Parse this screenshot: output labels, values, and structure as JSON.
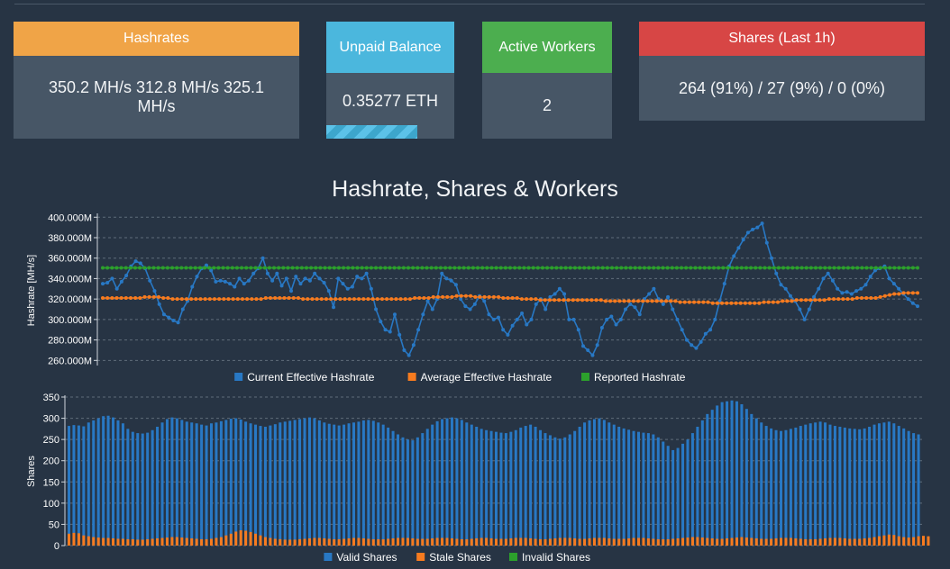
{
  "cards": {
    "hashrates": {
      "title": "Hashrates",
      "value": "350.2 MH/s  312.8 MH/s   325.1 MH/s"
    },
    "unpaid": {
      "title": "Unpaid Balance",
      "value": "0.35277 ETH",
      "progress": 0.71
    },
    "workers": {
      "title": "Active Workers",
      "value": "2"
    },
    "shares": {
      "title": "Shares (Last 1h)",
      "value": "264 (91%) / 27 (9%) / 0 (0%)"
    }
  },
  "title": "Hashrate, Shares & Workers",
  "colors": {
    "current": "#2878c4",
    "average": "#f77b1f",
    "reported": "#2ca02c",
    "valid": "#2878c4",
    "stale": "#f77b1f",
    "invalid": "#2ca02c"
  },
  "chart_data": [
    {
      "type": "line",
      "ylabel": "Hashrate [MH/s]",
      "ylim": [
        255,
        402
      ],
      "yticks": [
        "400.000M",
        "380.000M",
        "360.000M",
        "340.000M",
        "320.000M",
        "300.000M",
        "280.000M",
        "260.000M"
      ],
      "ytick_values": [
        400,
        380,
        360,
        340,
        320,
        300,
        280,
        260
      ],
      "grid": true,
      "legend_position": "bottom",
      "series": [
        {
          "name": "Current Effective Hashrate",
          "values": [
            335,
            336,
            340,
            330,
            337,
            343,
            352,
            357,
            355,
            350,
            338,
            328,
            315,
            305,
            302,
            299,
            297,
            310,
            318,
            332,
            342,
            350,
            353,
            348,
            337,
            338,
            337,
            335,
            332,
            340,
            335,
            338,
            345,
            350,
            360,
            345,
            338,
            345,
            333,
            340,
            328,
            342,
            335,
            340,
            338,
            345,
            340,
            336,
            328,
            312,
            340,
            335,
            330,
            332,
            342,
            340,
            345,
            330,
            310,
            298,
            290,
            288,
            305,
            285,
            270,
            265,
            275,
            290,
            305,
            318,
            310,
            320,
            345,
            340,
            338,
            334,
            320,
            313,
            310,
            315,
            323,
            318,
            305,
            300,
            302,
            290,
            285,
            294,
            300,
            306,
            295,
            300,
            315,
            320,
            310,
            322,
            325,
            330,
            325,
            300,
            300,
            290,
            274,
            270,
            265,
            275,
            292,
            300,
            303,
            295,
            300,
            310,
            315,
            312,
            305,
            320,
            325,
            330,
            320,
            315,
            322,
            310,
            300,
            290,
            280,
            275,
            272,
            278,
            286,
            290,
            300,
            318,
            335,
            352,
            362,
            370,
            378,
            385,
            388,
            390,
            394,
            375,
            360,
            345,
            334,
            330,
            323,
            318,
            310,
            300,
            310,
            322,
            330,
            340,
            345,
            338,
            330,
            326,
            327,
            325,
            328,
            330,
            334,
            342,
            348,
            350,
            352,
            340,
            335,
            330,
            325,
            320,
            316,
            313
          ]
        },
        {
          "name": "Average Effective Hashrate",
          "values": [
            321,
            321,
            321,
            321,
            321,
            321,
            321,
            321,
            321,
            322,
            322,
            322,
            322,
            321,
            321,
            320,
            320,
            320,
            320,
            320,
            320,
            320,
            320,
            320,
            320,
            320,
            320,
            320,
            320,
            320,
            320,
            320,
            320,
            320,
            320,
            321,
            321,
            321,
            321,
            321,
            321,
            321,
            321,
            320,
            320,
            320,
            320,
            320,
            320,
            320,
            320,
            320,
            320,
            320,
            320,
            320,
            320,
            320,
            320,
            320,
            320,
            320,
            320,
            320,
            320,
            320,
            320,
            321,
            321,
            321,
            321,
            322,
            322,
            322,
            322,
            322,
            323,
            323,
            323,
            323,
            322,
            322,
            322,
            322,
            322,
            322,
            321,
            321,
            321,
            321,
            320,
            320,
            320,
            320,
            319,
            319,
            319,
            319,
            319,
            319,
            319,
            319,
            319,
            319,
            319,
            319,
            319,
            319,
            318,
            318,
            318,
            318,
            318,
            318,
            318,
            318,
            318,
            318,
            318,
            318,
            318,
            318,
            318,
            318,
            317,
            317,
            317,
            317,
            317,
            317,
            317,
            316,
            316,
            316,
            316,
            316,
            316,
            316,
            316,
            316,
            316,
            316,
            317,
            317,
            317,
            317,
            318,
            318,
            318,
            319,
            319,
            319,
            319,
            319,
            319,
            319,
            320,
            320,
            320,
            320,
            320,
            320,
            321,
            321,
            321,
            321,
            321,
            322,
            323,
            324,
            325,
            325,
            326,
            326,
            326,
            326
          ]
        },
        {
          "name": "Reported Hashrate",
          "values": [
            350.5,
            350.5,
            350.5,
            350.5,
            350.5,
            350.5,
            350.5,
            350.5,
            350.5,
            350.5,
            350.5,
            350.5,
            350.5,
            350.5,
            350.5,
            350.5,
            350.5,
            350.5,
            350.5,
            350.5,
            350.5,
            350.5,
            350.5,
            350.5,
            350.5,
            350.5,
            350.5,
            350.5,
            350.5,
            350.5,
            350.5,
            350.5,
            350.5,
            350.5,
            350.5,
            350.5,
            350.5,
            350.5,
            350.5,
            350.5,
            350.5,
            350.5,
            350.5,
            350.5,
            350.5,
            350.5,
            350.5,
            350.5,
            350.5,
            350.5,
            350.5,
            350.5,
            350.5,
            350.5,
            350.5,
            350.5,
            350.5,
            350.5,
            350.5,
            350.5,
            350.5,
            350.5,
            350.5,
            350.5,
            350.5,
            350.5,
            350.5,
            350.5,
            350.5,
            350.5,
            350.5,
            350.5,
            350.5,
            350.5,
            350.5,
            350.5,
            350.5,
            350.5,
            350.5,
            350.5,
            350.5,
            350.5,
            350.5,
            350.5,
            350.5,
            350.5,
            350.5,
            350.5,
            350.5,
            350.5,
            350.5,
            350.5,
            350.5,
            350.5,
            350.5,
            350.5,
            350.5,
            350.5,
            350.5,
            350.5,
            350.5,
            350.5,
            350.5,
            350.5,
            350.5,
            350.5,
            350.5,
            350.5,
            350.5,
            350.5,
            350.5,
            350.5,
            350.5,
            350.5,
            350.5,
            350.5,
            350.5,
            350.5,
            350.5,
            350.5,
            350.5,
            350.5,
            350.5,
            350.5,
            350.5,
            350.5,
            350.5,
            350.5,
            350.5,
            350.5,
            350.5,
            350.5,
            350.5,
            350.5,
            350.5,
            350.5,
            350.5,
            350.5,
            350.5,
            350.5,
            350.5,
            350.5,
            350.5,
            350.5,
            350.5,
            350.5,
            350.5,
            350.5,
            350.5,
            350.5,
            350.5,
            350.5,
            350.5,
            350.5,
            350.5,
            350.5,
            350.5,
            350.5,
            350.5,
            350.5,
            350.5,
            350.5,
            350.5,
            350.5,
            350.5,
            350.5,
            350.5,
            350.5,
            350.5,
            350.5,
            350.5,
            350.5,
            350.5,
            350.5,
            350.5,
            350.5,
            350.5
          ]
        }
      ]
    },
    {
      "type": "bar",
      "ylabel": "Shares",
      "ylim": [
        0,
        350
      ],
      "yticks": [
        "350",
        "300",
        "250",
        "200",
        "150",
        "100",
        "50",
        "0"
      ],
      "ytick_values": [
        350,
        300,
        250,
        200,
        150,
        100,
        50,
        0
      ],
      "grid": true,
      "legend_position": "bottom",
      "series": [
        {
          "name": "Valid Shares",
          "values": [
            282,
            284,
            283,
            281,
            290,
            295,
            300,
            305,
            306,
            302,
            295,
            288,
            275,
            268,
            265,
            264,
            266,
            272,
            280,
            290,
            298,
            302,
            300,
            296,
            292,
            290,
            288,
            285,
            283,
            288,
            290,
            293,
            296,
            299,
            300,
            297,
            292,
            288,
            285,
            282,
            280,
            283,
            286,
            290,
            292,
            294,
            296,
            298,
            300,
            302,
            300,
            295,
            290,
            287,
            285,
            283,
            285,
            288,
            290,
            292,
            295,
            296,
            294,
            290,
            285,
            278,
            270,
            262,
            255,
            250,
            248,
            255,
            265,
            275,
            285,
            293,
            298,
            300,
            302,
            300,
            296,
            290,
            285,
            280,
            275,
            272,
            270,
            268,
            266,
            265,
            268,
            272,
            278,
            282,
            285,
            280,
            272,
            265,
            260,
            255,
            252,
            255,
            262,
            270,
            280,
            290,
            295,
            298,
            300,
            296,
            290,
            285,
            280,
            276,
            273,
            270,
            268,
            266,
            265,
            262,
            255,
            245,
            235,
            225,
            230,
            240,
            250,
            265,
            280,
            295,
            310,
            320,
            330,
            338,
            340,
            342,
            340,
            333,
            322,
            310,
            300,
            290,
            282,
            276,
            272,
            270,
            272,
            275,
            278,
            282,
            285,
            288,
            290,
            292,
            290,
            285,
            282,
            280,
            278,
            276,
            275,
            274,
            276,
            280,
            285,
            288,
            290,
            292,
            288,
            282,
            276,
            270,
            265,
            262
          ]
        },
        {
          "name": "Stale Shares",
          "values": [
            28,
            30,
            29,
            24,
            22,
            20,
            19,
            18,
            18,
            17,
            16,
            16,
            15,
            15,
            14,
            14,
            15,
            16,
            17,
            18,
            19,
            20,
            20,
            19,
            18,
            17,
            16,
            15,
            15,
            16,
            18,
            20,
            24,
            28,
            33,
            36,
            35,
            32,
            28,
            24,
            20,
            18,
            16,
            15,
            14,
            14,
            14,
            15,
            16,
            17,
            18,
            18,
            17,
            16,
            15,
            15,
            16,
            17,
            18,
            18,
            17,
            16,
            15,
            15,
            15,
            16,
            17,
            18,
            18,
            18,
            17,
            16,
            16,
            16,
            17,
            18,
            18,
            18,
            17,
            16,
            15,
            15,
            16,
            17,
            18,
            18,
            17,
            16,
            16,
            16,
            17,
            18,
            18,
            18,
            17,
            16,
            15,
            15,
            16,
            17,
            18,
            18,
            18,
            17,
            16,
            16,
            17,
            18,
            18,
            18,
            17,
            16,
            16,
            16,
            17,
            18,
            18,
            18,
            17,
            16,
            15,
            15,
            15,
            16,
            17,
            18,
            19,
            20,
            20,
            19,
            18,
            17,
            16,
            16,
            17,
            18,
            19,
            20,
            19,
            18,
            17,
            16,
            16,
            16,
            17,
            18,
            18,
            18,
            17,
            16,
            15,
            15,
            15,
            16,
            17,
            18,
            18,
            18,
            17,
            16,
            16,
            16,
            17,
            18,
            20,
            22,
            24,
            26,
            25,
            22,
            20,
            19,
            20,
            22,
            23,
            22
          ]
        },
        {
          "name": "Invalid Shares",
          "values": []
        }
      ]
    }
  ]
}
